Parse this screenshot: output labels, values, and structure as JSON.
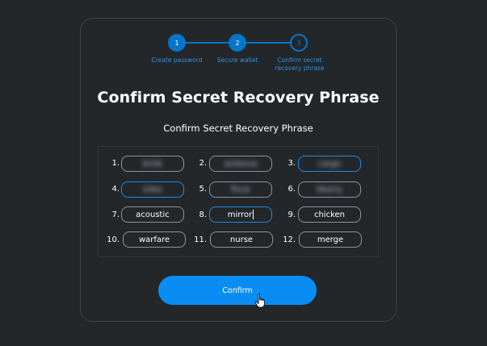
{
  "stepper": {
    "steps": [
      {
        "number": "1",
        "label": "Create password",
        "state": "done"
      },
      {
        "number": "2",
        "label": "Secure wallet",
        "state": "done"
      },
      {
        "number": "3",
        "label": "Confirm secret recovery phrase",
        "state": "todo"
      }
    ]
  },
  "page": {
    "title": "Confirm Secret Recovery Phrase",
    "subtitle": "Confirm Secret Recovery Phrase"
  },
  "words": [
    {
      "number": "1.",
      "value": "brisk",
      "blurred": true,
      "active": false
    },
    {
      "number": "2.",
      "value": "antenna",
      "blurred": true,
      "active": false
    },
    {
      "number": "3.",
      "value": "cargo",
      "blurred": true,
      "active": true
    },
    {
      "number": "4.",
      "value": "tribe",
      "blurred": true,
      "active": true
    },
    {
      "number": "5.",
      "value": "flock",
      "blurred": true,
      "active": false
    },
    {
      "number": "6.",
      "value": "liberty",
      "blurred": true,
      "active": false
    },
    {
      "number": "7.",
      "value": "acoustic",
      "blurred": false,
      "active": false
    },
    {
      "number": "8.",
      "value": "mirror",
      "blurred": false,
      "active": false,
      "focused": true
    },
    {
      "number": "9.",
      "value": "chicken",
      "blurred": false,
      "active": false
    },
    {
      "number": "10.",
      "value": "warfare",
      "blurred": false,
      "active": false
    },
    {
      "number": "11.",
      "value": "nurse",
      "blurred": false,
      "active": false
    },
    {
      "number": "12.",
      "value": "merge",
      "blurred": false,
      "active": false
    }
  ],
  "actions": {
    "confirm_label": "Confirm"
  },
  "colors": {
    "background": "#24272a",
    "accent": "#0376c9",
    "button": "#0a8df2"
  }
}
